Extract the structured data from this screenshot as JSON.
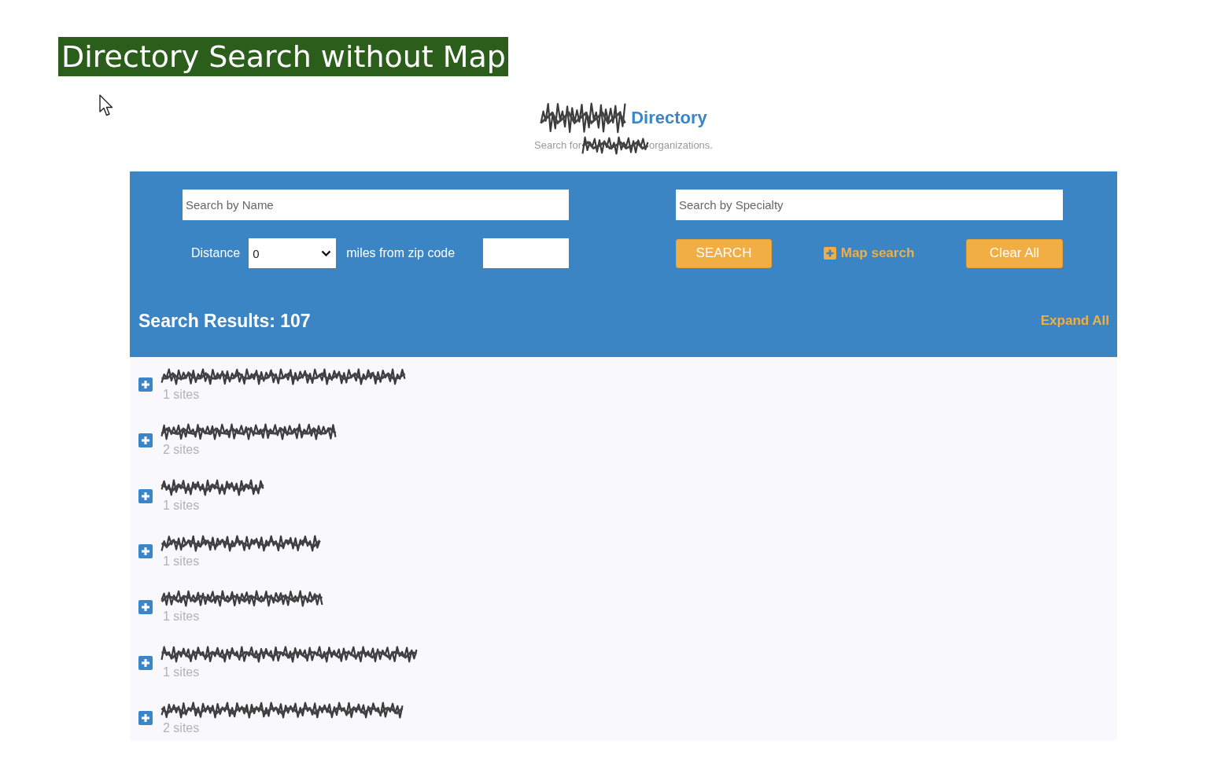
{
  "banner": {
    "title": "Directory Search without Map"
  },
  "header": {
    "title": "Directory",
    "subtitle_before": "Search for",
    "subtitle_after": "organizations."
  },
  "search": {
    "name_field": {
      "placeholder": "Search by Name"
    },
    "specialty_field": {
      "placeholder": "Search by Specialty"
    },
    "distance": {
      "label": "Distance",
      "value": "0"
    },
    "zip_label": "miles from zip code",
    "search_button": {
      "label": "SEARCH"
    },
    "map_search_link": {
      "label": "Map search"
    },
    "clear_button": {
      "label": "Clear All"
    }
  },
  "results": {
    "heading": "Search Results: 107",
    "expand_all": "Expand All",
    "items": [
      {
        "sites": "1 sites",
        "expanded": false
      },
      {
        "sites": "2 sites",
        "expanded": false
      },
      {
        "sites": "1 sites",
        "expanded": false
      },
      {
        "sites": "1 sites",
        "expanded": false
      },
      {
        "sites": "1 sites",
        "expanded": false
      },
      {
        "sites": "1 sites",
        "expanded": false
      },
      {
        "sites": "2 sites",
        "expanded": false
      }
    ]
  }
}
